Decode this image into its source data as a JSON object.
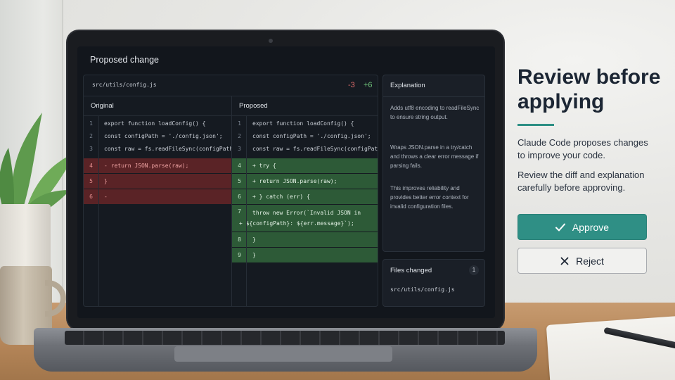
{
  "screen": {
    "title": "Proposed change",
    "diff": {
      "file_path": "src/utils/config.js",
      "deletions": "-3",
      "additions": "+6",
      "original_label": "Original",
      "proposed_label": "Proposed",
      "original_lines": [
        {
          "num": "1",
          "text": "export function loadConfig() {",
          "type": "context"
        },
        {
          "num": "2",
          "text": "  const configPath = './config.json';",
          "type": "context"
        },
        {
          "num": "3",
          "text": "  const raw = fs.readFileSync(configPath);",
          "type": "context"
        },
        {
          "num": "4",
          "text": "- return JSON.parse(raw);",
          "type": "del"
        },
        {
          "num": "5",
          "text": "}",
          "type": "del"
        },
        {
          "num": "6",
          "text": "-",
          "type": "del"
        }
      ],
      "proposed_lines": [
        {
          "num": "1",
          "text": "export function loadConfig() {",
          "type": "context"
        },
        {
          "num": "2",
          "text": "  const configPath = './config.json';",
          "type": "context"
        },
        {
          "num": "3",
          "text": "  const raw = fs.readFileSync(configPath,",
          "type": "context"
        },
        {
          "num": "4",
          "text": "+ try {",
          "type": "add"
        },
        {
          "num": "5",
          "text": "+   return JSON.parse(raw);",
          "type": "add"
        },
        {
          "num": "6",
          "text": "+ } catch (err) {",
          "type": "add"
        },
        {
          "num": "7",
          "text": "    throw new Error(`Invalid JSON in",
          "text2": "+     ${configPath}: ${err.message}`);",
          "type": "add"
        },
        {
          "num": "8",
          "text": "  }",
          "type": "add"
        },
        {
          "num": "9",
          "text": "}",
          "type": "add"
        }
      ]
    },
    "explanation": {
      "title": "Explanation",
      "p1": "Adds utf8 encoding to readFileSync to ensure string output.",
      "p2": "Wraps JSON.parse in a try/catch and throws a clear error message if parsing fails.",
      "p3": "This improves reliability and provides better error context for invalid configuration files."
    },
    "files_changed": {
      "title": "Files changed",
      "count": "1",
      "items": [
        "src/utils/config.js"
      ]
    }
  },
  "overlay": {
    "headline": "Review before applying",
    "para1": "Claude Code proposes changes to improve your code.",
    "para2": "Review the diff and explanation carefully before approving.",
    "approve_label": "Approve",
    "reject_label": "Reject",
    "approve_color": "#2f8f85",
    "accent_color": "#2d8f84"
  },
  "colors": {
    "deleted_bg": "#5a2326",
    "added_bg": "#2d5a37",
    "deletions_text": "#e06c6c",
    "additions_text": "#6fc27a"
  }
}
